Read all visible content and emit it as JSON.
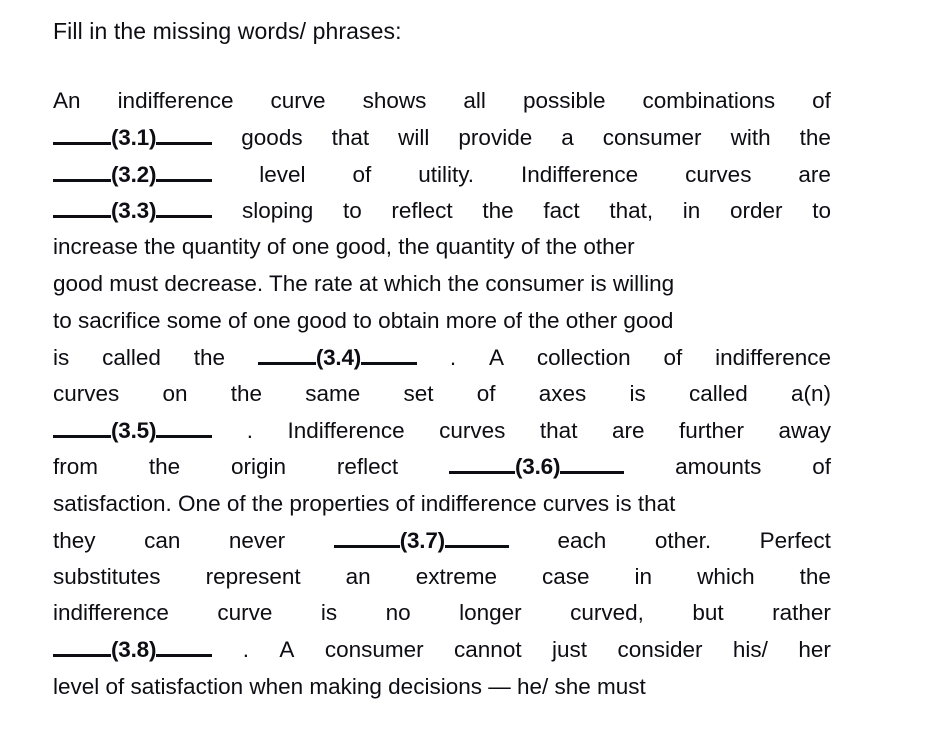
{
  "document": {
    "heading": "Fill in the missing words/ phrases:",
    "paragraph_text": "An indifference curve shows all possible combinations of ____(3.1)____ goods that will provide a consumer with the ____(3.2)____ level of utility. Indifference curves are ____(3.3)____ sloping to reflect the fact that, in order to increase the quantity of one good, the quantity of the other good must decrease. The rate at which the consumer is willing to sacrifice some of one good to obtain more of the other good is called the ____(3.4)____. A collection of indifference curves on the same set of axes is called a(n) ____(3.5)____. Indifference curves that are further away from the origin reflect ____(3.6)____ amounts of satisfaction. One of the properties of indifference curves is that they can never ____(3.7)____ each other. Perfect substitutes represent an extreme case in which the indifference curve is no longer curved, but rather ____(3.8)____. A consumer cannot just consider his/ her level of satisfaction when making decisions — he/ she must",
    "blank_labels": [
      "(3.1)",
      "(3.2)",
      "(3.3)",
      "(3.4)",
      "(3.5)",
      "(3.6)",
      "(3.7)",
      "(3.8)"
    ],
    "lines": [
      {
        "id": "l1",
        "align": "justify",
        "segments": [
          {
            "t": "An"
          },
          {
            "t": "indifference"
          },
          {
            "t": "curve"
          },
          {
            "t": "shows"
          },
          {
            "t": "all"
          },
          {
            "t": "possible"
          },
          {
            "t": "combinations"
          },
          {
            "t": "of"
          }
        ]
      },
      {
        "id": "l2",
        "align": "justify",
        "segments": [
          {
            "blank": "(3.1)"
          },
          {
            "t": "goods"
          },
          {
            "t": "that"
          },
          {
            "t": "will"
          },
          {
            "t": "provide"
          },
          {
            "t": "a"
          },
          {
            "t": "consumer"
          },
          {
            "t": "with"
          },
          {
            "t": "the"
          }
        ]
      },
      {
        "id": "l3",
        "align": "justify",
        "segments": [
          {
            "blank": "(3.2)"
          },
          {
            "t": "level"
          },
          {
            "t": "of"
          },
          {
            "t": "utility."
          },
          {
            "t": "Indifference"
          },
          {
            "t": "curves"
          },
          {
            "t": "are"
          }
        ]
      },
      {
        "id": "l4",
        "align": "justify",
        "segments": [
          {
            "blank": "(3.3)"
          },
          {
            "t": "sloping"
          },
          {
            "t": "to"
          },
          {
            "t": "reflect"
          },
          {
            "t": "the"
          },
          {
            "t": "fact"
          },
          {
            "t": "that,"
          },
          {
            "t": "in"
          },
          {
            "t": "order"
          },
          {
            "t": "to"
          }
        ]
      },
      {
        "id": "l5",
        "align": "flush",
        "segments": [
          {
            "t": "increase the quantity of one good, the quantity of the other"
          }
        ]
      },
      {
        "id": "l6",
        "align": "flush",
        "segments": [
          {
            "t": "good must decrease. The rate at which the consumer is willing"
          }
        ]
      },
      {
        "id": "l7",
        "align": "flush",
        "segments": [
          {
            "t": "to sacrifice some of one good to obtain more of the other good"
          }
        ]
      },
      {
        "id": "l8",
        "align": "justify",
        "segments": [
          {
            "t": "is"
          },
          {
            "t": "called"
          },
          {
            "t": "the"
          },
          {
            "blank": "(3.4)",
            "after": "."
          },
          {
            "t": "A"
          },
          {
            "t": "collection"
          },
          {
            "t": "of"
          },
          {
            "t": "indifference"
          }
        ]
      },
      {
        "id": "l9",
        "align": "justify",
        "segments": [
          {
            "t": "curves"
          },
          {
            "t": "on"
          },
          {
            "t": "the"
          },
          {
            "t": "same"
          },
          {
            "t": "set"
          },
          {
            "t": "of"
          },
          {
            "t": "axes"
          },
          {
            "t": "is"
          },
          {
            "t": "called"
          },
          {
            "t": "a(n)"
          }
        ]
      },
      {
        "id": "l10",
        "align": "justify",
        "segments": [
          {
            "blank": "(3.5)",
            "after": "."
          },
          {
            "t": "Indifference"
          },
          {
            "t": "curves"
          },
          {
            "t": "that"
          },
          {
            "t": "are"
          },
          {
            "t": "further"
          },
          {
            "t": "away"
          }
        ]
      },
      {
        "id": "l11",
        "align": "justify",
        "segments": [
          {
            "t": "from"
          },
          {
            "t": "the"
          },
          {
            "t": "origin"
          },
          {
            "t": "reflect"
          },
          {
            "blank": "(3.6)",
            "width": "wide"
          },
          {
            "t": "amounts"
          },
          {
            "t": "of"
          }
        ]
      },
      {
        "id": "l12",
        "align": "flush",
        "segments": [
          {
            "t": "satisfaction. One of the properties of indifference curves is that"
          }
        ]
      },
      {
        "id": "l13",
        "align": "justify",
        "segments": [
          {
            "t": "they"
          },
          {
            "t": "can"
          },
          {
            "t": "never"
          },
          {
            "blank": "(3.7)",
            "width": "wide"
          },
          {
            "t": "each"
          },
          {
            "t": "other."
          },
          {
            "t": "Perfect"
          }
        ]
      },
      {
        "id": "l14",
        "align": "justify",
        "segments": [
          {
            "t": "substitutes"
          },
          {
            "t": "represent"
          },
          {
            "t": "an"
          },
          {
            "t": "extreme"
          },
          {
            "t": "case"
          },
          {
            "t": "in"
          },
          {
            "t": "which"
          },
          {
            "t": "the"
          }
        ]
      },
      {
        "id": "l15",
        "align": "justify",
        "segments": [
          {
            "t": "indifference"
          },
          {
            "t": "curve"
          },
          {
            "t": "is"
          },
          {
            "t": "no"
          },
          {
            "t": "longer"
          },
          {
            "t": "curved,"
          },
          {
            "t": "but"
          },
          {
            "t": "rather"
          }
        ]
      },
      {
        "id": "l16",
        "align": "justify",
        "segments": [
          {
            "blank": "(3.8)",
            "after": "."
          },
          {
            "t": "A"
          },
          {
            "t": "consumer"
          },
          {
            "t": "cannot"
          },
          {
            "t": "just"
          },
          {
            "t": "consider"
          },
          {
            "t": "his/"
          },
          {
            "t": "her"
          }
        ]
      },
      {
        "id": "l17",
        "align": "flush",
        "segments": [
          {
            "t": "level of satisfaction when making decisions — he/ she must"
          }
        ]
      }
    ]
  },
  "colors": {
    "page_background": "#ffffff",
    "text": "#0d0d14",
    "blank_rule": "#0d0d14"
  }
}
